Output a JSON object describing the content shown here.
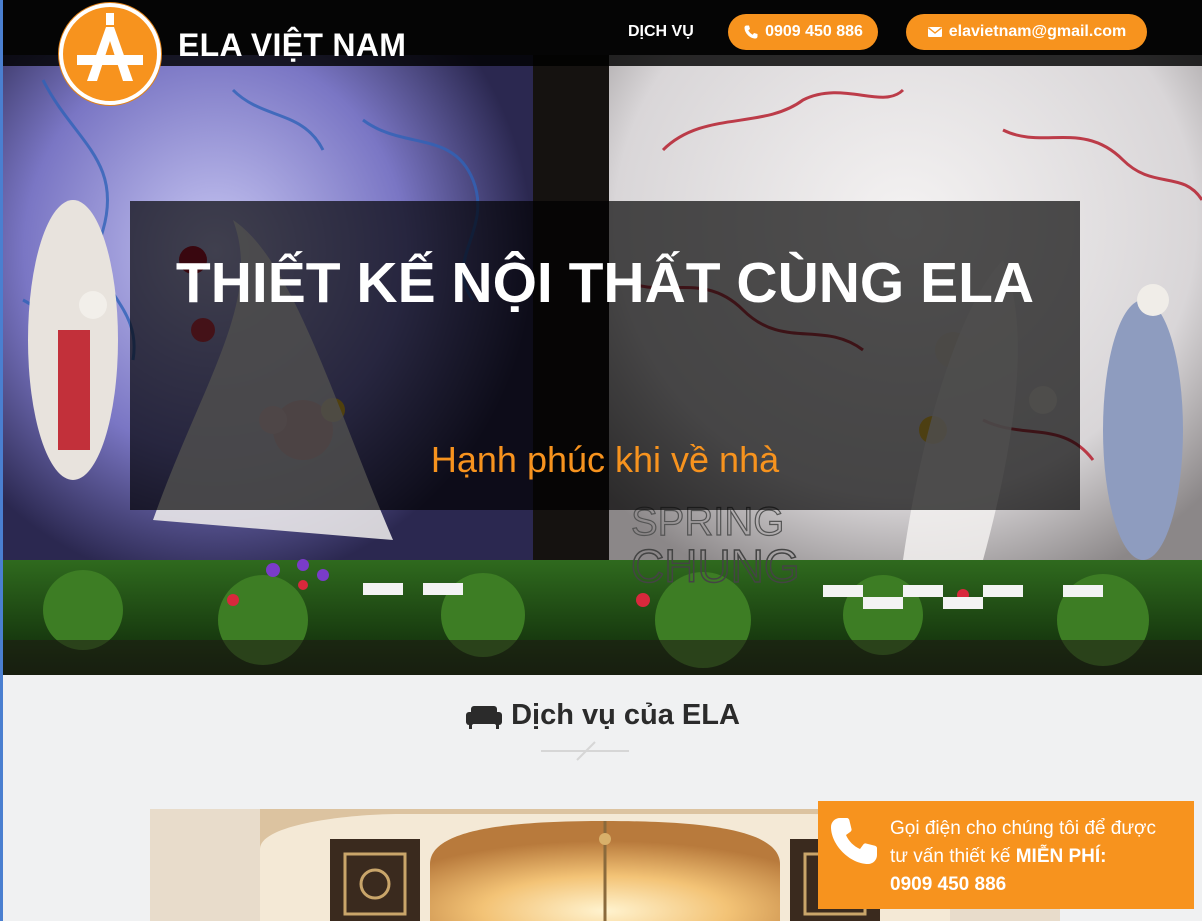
{
  "header": {
    "brand": "ELA VIỆT NAM",
    "logo_letter": "A",
    "nav_services": "DỊCH VỤ",
    "phone": "0909 450 886",
    "email": "elavietnam@gmail.com"
  },
  "hero": {
    "title": "THIẾT KẾ NỘI THẤT CÙNG ELA",
    "subtitle": "Hạnh phúc khi về nhà",
    "background_text_1": "SPRING",
    "background_text_2": "CHUNG"
  },
  "services": {
    "title": "Dịch vụ của ELA"
  },
  "callbox": {
    "line1": "Gọi điện cho chúng tôi để được",
    "line2_prefix": "tư vấn thiết kế ",
    "line2_bold": "MIỄN PHÍ:",
    "phone": "0909 450 886"
  },
  "colors": {
    "accent": "#f7931e",
    "header_bg": "#000000",
    "page_bg": "#f0f1f2"
  },
  "icons": {
    "logo": "ela-logo-icon",
    "phone": "phone-icon",
    "email": "envelope-icon",
    "sofa": "sofa-icon",
    "call": "phone-handset-icon"
  }
}
